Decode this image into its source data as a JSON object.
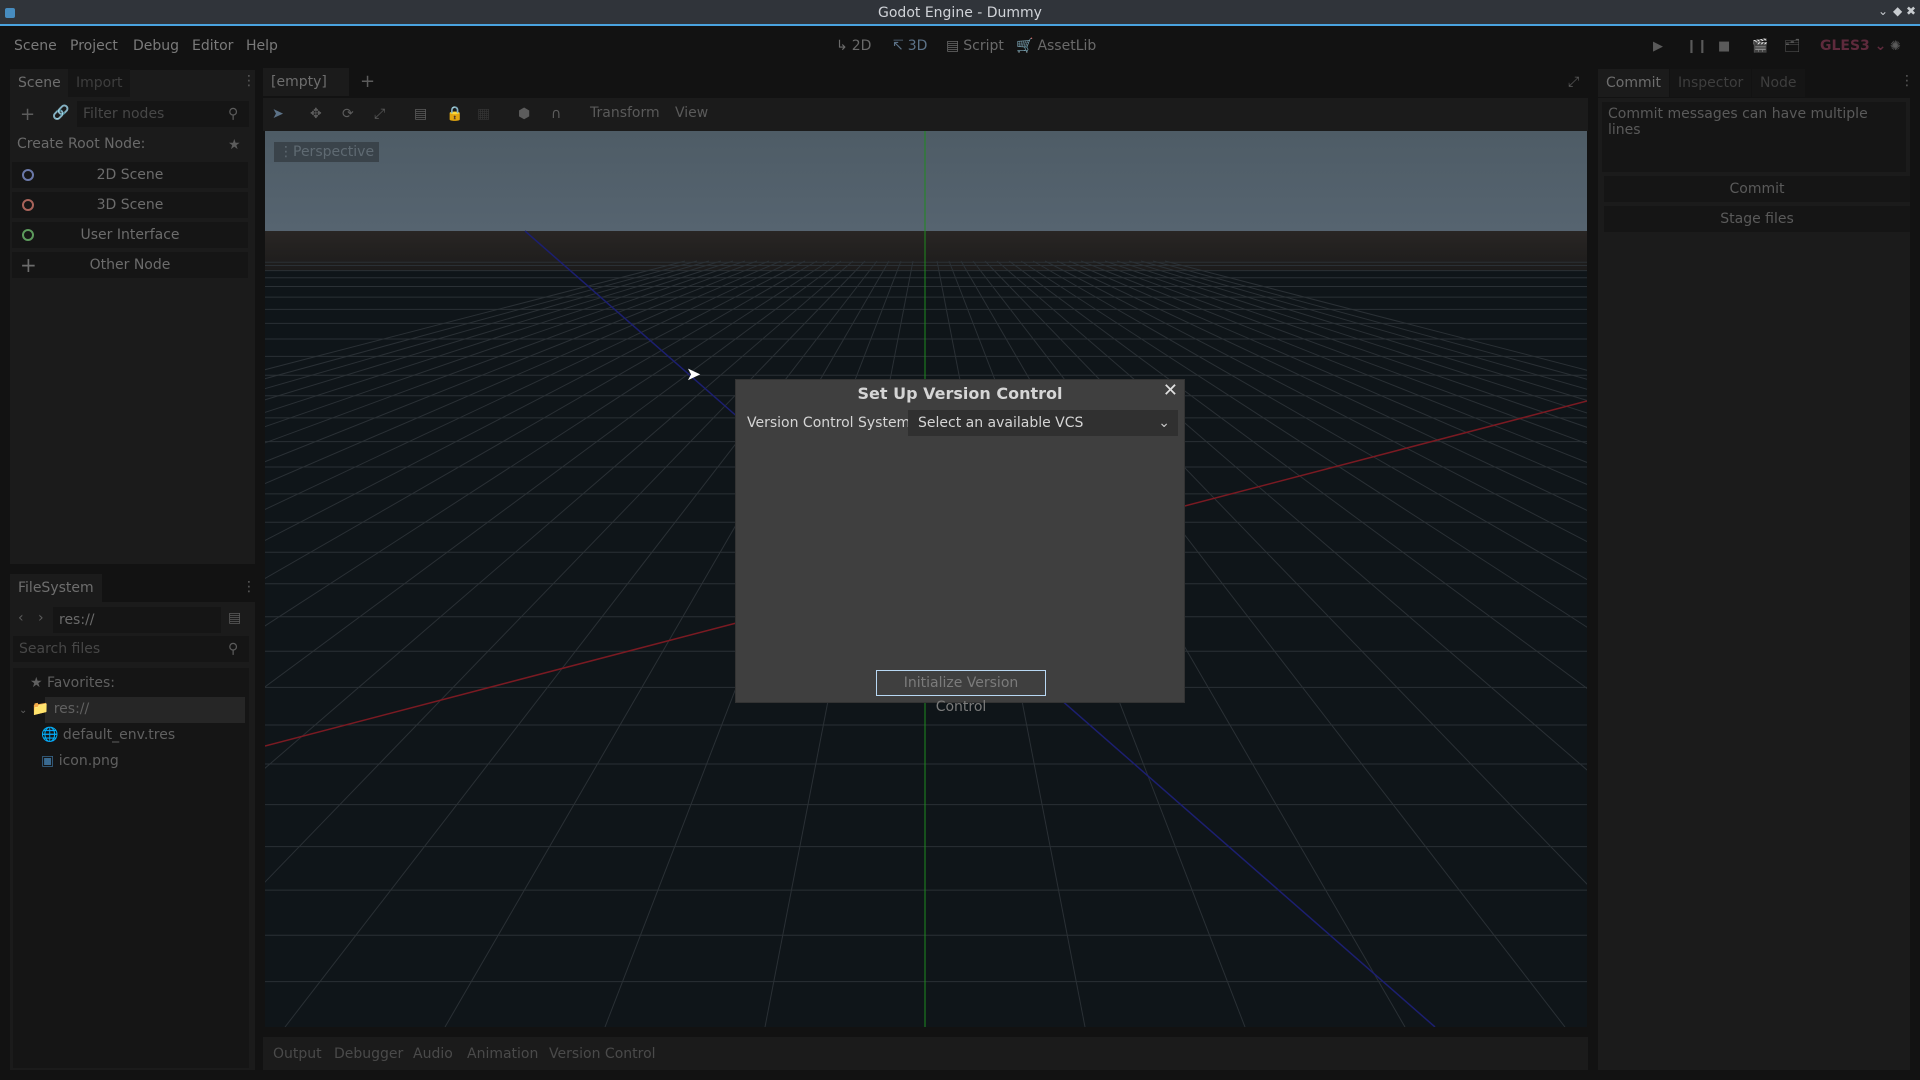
{
  "window": {
    "title": "Godot Engine - Dummy"
  },
  "menu": [
    "Scene",
    "Project",
    "Debug",
    "Editor",
    "Help"
  ],
  "main_modes": [
    {
      "label": "2D",
      "icon": "2d-icon",
      "active": false
    },
    {
      "label": "3D",
      "icon": "3d-icon",
      "active": true
    },
    {
      "label": "Script",
      "icon": "script-icon",
      "active": false
    },
    {
      "label": "AssetLib",
      "icon": "assetlib-icon",
      "active": false
    }
  ],
  "renderer": "GLES3",
  "colors": {
    "accent": "#4aa3df",
    "renderer": "#5e2a3c",
    "x_axis": "#a8202a",
    "y_axis": "#1e8a1e",
    "z_axis": "#1c1f8a"
  },
  "scene_dock": {
    "tabs": [
      "Scene",
      "Import"
    ],
    "filter_placeholder": "Filter nodes",
    "create_root_label": "Create Root Node:",
    "root_nodes": [
      {
        "label": "2D Scene",
        "icon": "node2d-icon",
        "color": "#6a78a8"
      },
      {
        "label": "3D Scene",
        "icon": "spatial-icon",
        "color": "#a8635a"
      },
      {
        "label": "User Interface",
        "icon": "control-icon",
        "color": "#5c9a5c"
      },
      {
        "label": "Other Node",
        "icon": "add-icon",
        "color": "#6c6c6c"
      }
    ]
  },
  "filesystem": {
    "tab": "FileSystem",
    "path": "res://",
    "search_placeholder": "Search files",
    "favorites_label": "Favorites:",
    "root": "res://",
    "files": [
      "default_env.tres",
      "icon.png"
    ]
  },
  "editor_tabs": {
    "current": "[empty]"
  },
  "toolbar": {
    "transform": "Transform",
    "view": "View"
  },
  "viewport": {
    "label": "Perspective"
  },
  "dialog": {
    "title": "Set Up Version Control",
    "vcs_label": "Version Control System",
    "vcs_select": "Select an available VCS",
    "init_button": "Initialize Version Control"
  },
  "bottom_tabs": [
    "Output",
    "Debugger",
    "Audio",
    "Animation",
    "Version Control"
  ],
  "right_dock": {
    "tabs": [
      "Commit",
      "Inspector",
      "Node"
    ],
    "commit_placeholder": "Commit messages can have multiple lines",
    "commit_button": "Commit",
    "stage_button": "Stage files"
  }
}
